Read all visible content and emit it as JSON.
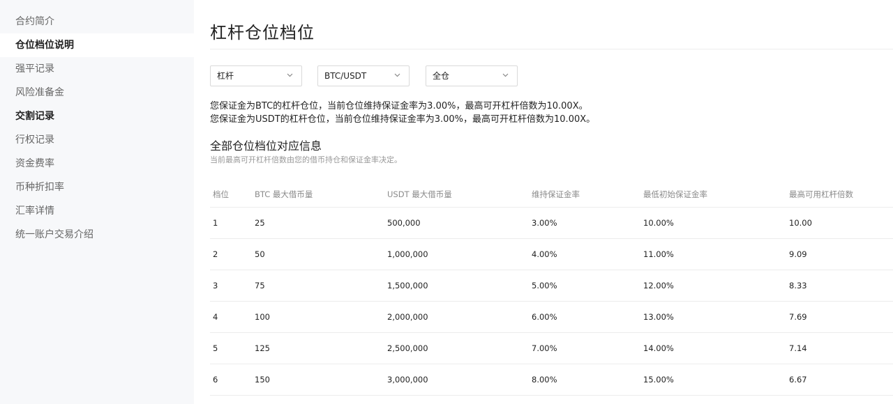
{
  "sidebar": {
    "items": [
      {
        "label": "合约简介"
      },
      {
        "label": "仓位档位说明"
      },
      {
        "label": "强平记录"
      },
      {
        "label": "风险准备金"
      },
      {
        "label": "交割记录"
      },
      {
        "label": "行权记录"
      },
      {
        "label": "资金费率"
      },
      {
        "label": "币种折扣率"
      },
      {
        "label": "汇率详情"
      },
      {
        "label": "统一账户交易介绍"
      }
    ]
  },
  "main": {
    "title": "杠杆仓位档位",
    "filters": {
      "type": "杠杆",
      "pair": "BTC/USDT",
      "mode": "全仓"
    },
    "info_lines": [
      "您保证金为BTC的杠杆仓位，当前仓位维持保证金率为3.00%，最高可开杠杆倍数为10.00X。",
      "您保证金为USDT的杠杆仓位，当前仓位维持保证金率为3.00%，最高可开杠杆倍数为10.00X。"
    ],
    "section_title": "全部仓位档位对应信息",
    "section_subtitle": "当前最高可开杠杆倍数由您的借币持仓和保证金率决定。",
    "table": {
      "headers": [
        "档位",
        "BTC 最大借币量",
        "USDT 最大借币量",
        "维持保证金率",
        "最低初始保证金率",
        "最高可用杠杆倍数"
      ],
      "rows": [
        [
          "1",
          "25",
          "500,000",
          "3.00%",
          "10.00%",
          "10.00"
        ],
        [
          "2",
          "50",
          "1,000,000",
          "4.00%",
          "11.00%",
          "9.09"
        ],
        [
          "3",
          "75",
          "1,500,000",
          "5.00%",
          "12.00%",
          "8.33"
        ],
        [
          "4",
          "100",
          "2,000,000",
          "6.00%",
          "13.00%",
          "7.69"
        ],
        [
          "5",
          "125",
          "2,500,000",
          "7.00%",
          "14.00%",
          "7.14"
        ],
        [
          "6",
          "150",
          "3,000,000",
          "8.00%",
          "15.00%",
          "6.67"
        ]
      ]
    }
  }
}
